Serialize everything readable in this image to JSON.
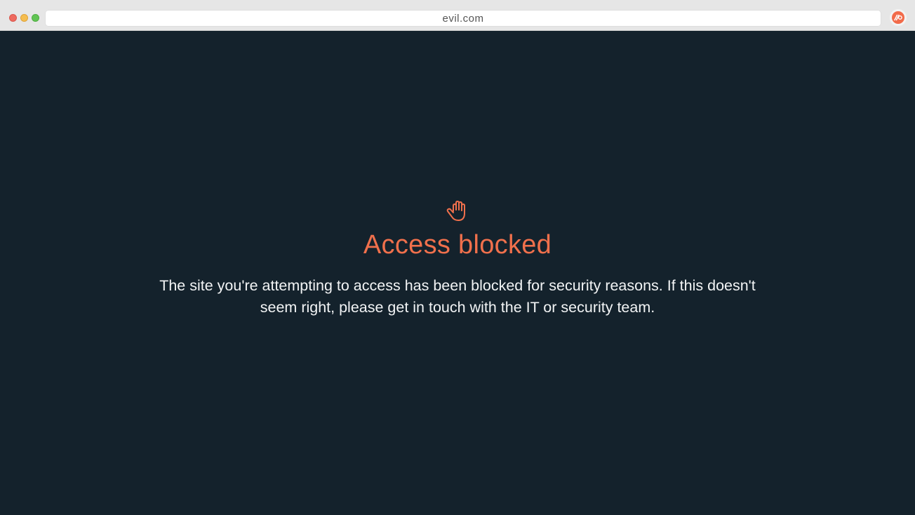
{
  "browser": {
    "url": "evil.com",
    "window_controls": [
      "close",
      "minimize",
      "maximize"
    ],
    "extension_icon": "security-extension-icon"
  },
  "block_page": {
    "icon": "raised-hand-icon",
    "title": "Access blocked",
    "message": "The site you're attempting to access has been blocked for security reasons. If this doesn't seem right, please get in touch with the IT or security team."
  },
  "colors": {
    "background": "#14222c",
    "accent": "#f0704c",
    "text": "#f2f4f5",
    "titlebar": "#e6e6e6"
  }
}
